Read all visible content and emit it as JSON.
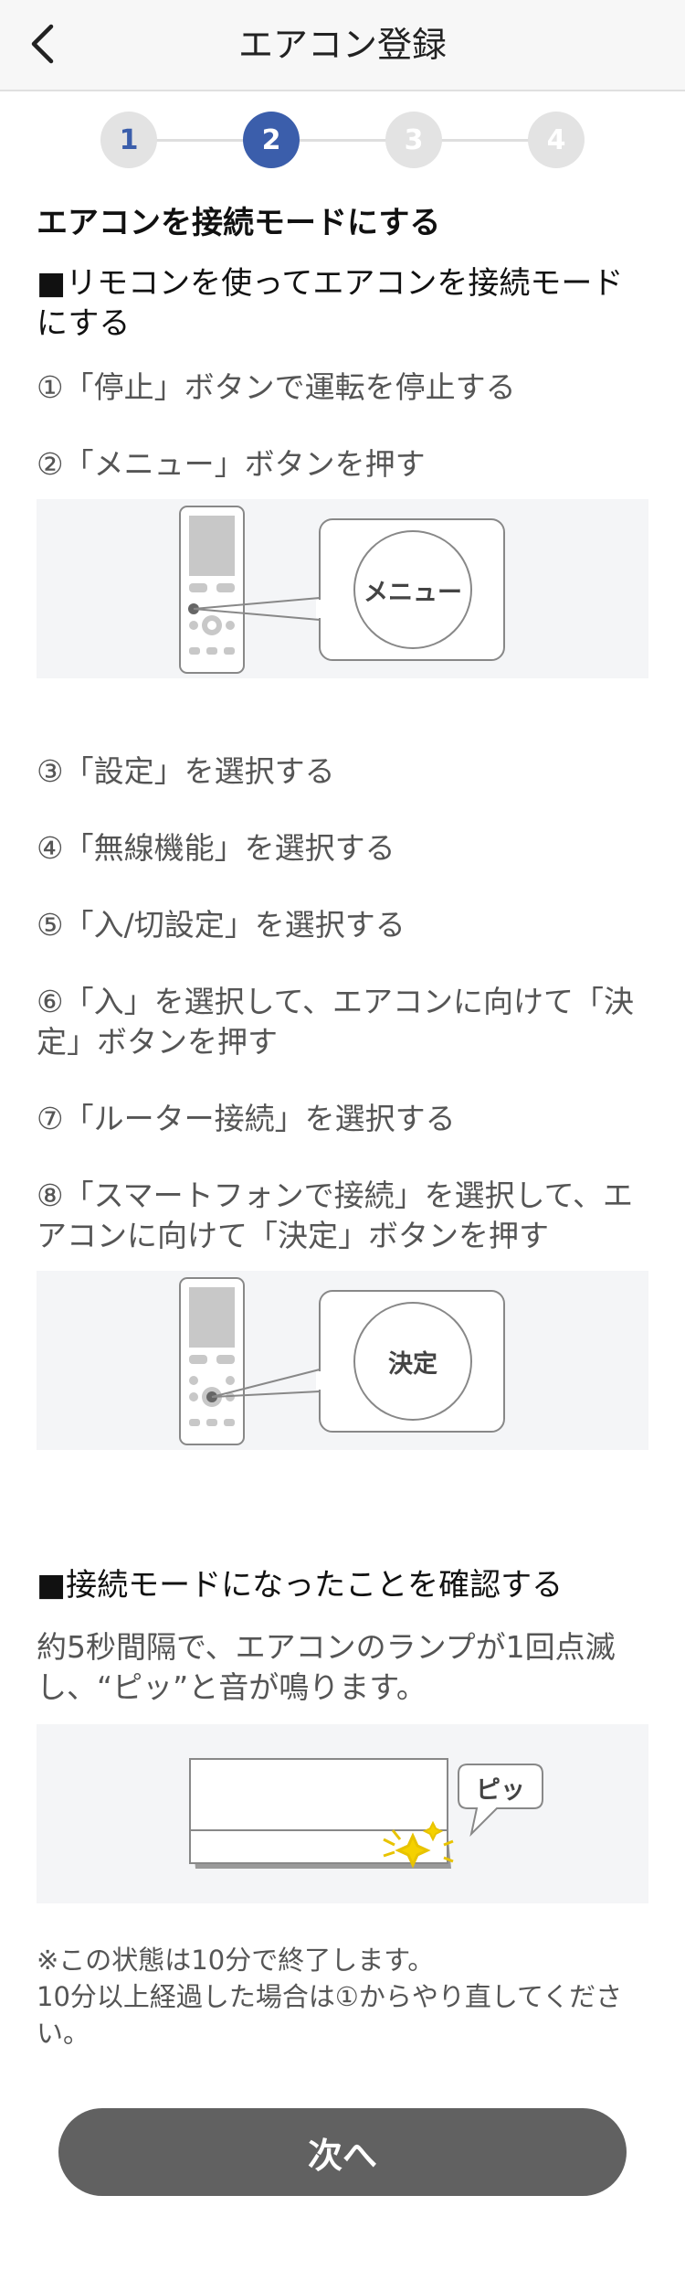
{
  "header": {
    "title": "エアコン登録",
    "back_icon": "chevron-left-icon"
  },
  "stepper": {
    "steps": [
      "1",
      "2",
      "3",
      "4"
    ],
    "current": 2
  },
  "section1": {
    "heading": "エアコンを接続モードにする",
    "subheading": "■リモコンを使ってエアコンを接続モードにする",
    "steps": [
      "①「停止」ボタンで運転を停止する",
      "②「メニュー」ボタンを押す",
      "③「設定」を選択する",
      "④「無線機能」を選択する",
      "⑤「入/切設定」を選択する",
      "⑥「入」を選択して、エアコンに向けて「決定」ボタンを押す",
      "⑦「ルーター接続」を選択する",
      "⑧「スマートフォンで接続」を選択して、エアコンに向けて「決定」ボタンを押す"
    ],
    "illustration1_label": "メニュー",
    "illustration2_label": "決定"
  },
  "section2": {
    "subheading": "■接続モードになったことを確認する",
    "body": "約5秒間隔で、エアコンのランプが1回点滅し、“ピッ”と音が鳴ります。",
    "illustration_label": "ピッ"
  },
  "note": {
    "line1": "※この状態は10分で終了します。",
    "line2": "10分以上経過した場合は①からやり直してください。"
  },
  "next_button": {
    "label": "次へ"
  },
  "colors": {
    "accent": "#3b5eab",
    "button": "#616161",
    "panel": "#f4f5f7"
  }
}
